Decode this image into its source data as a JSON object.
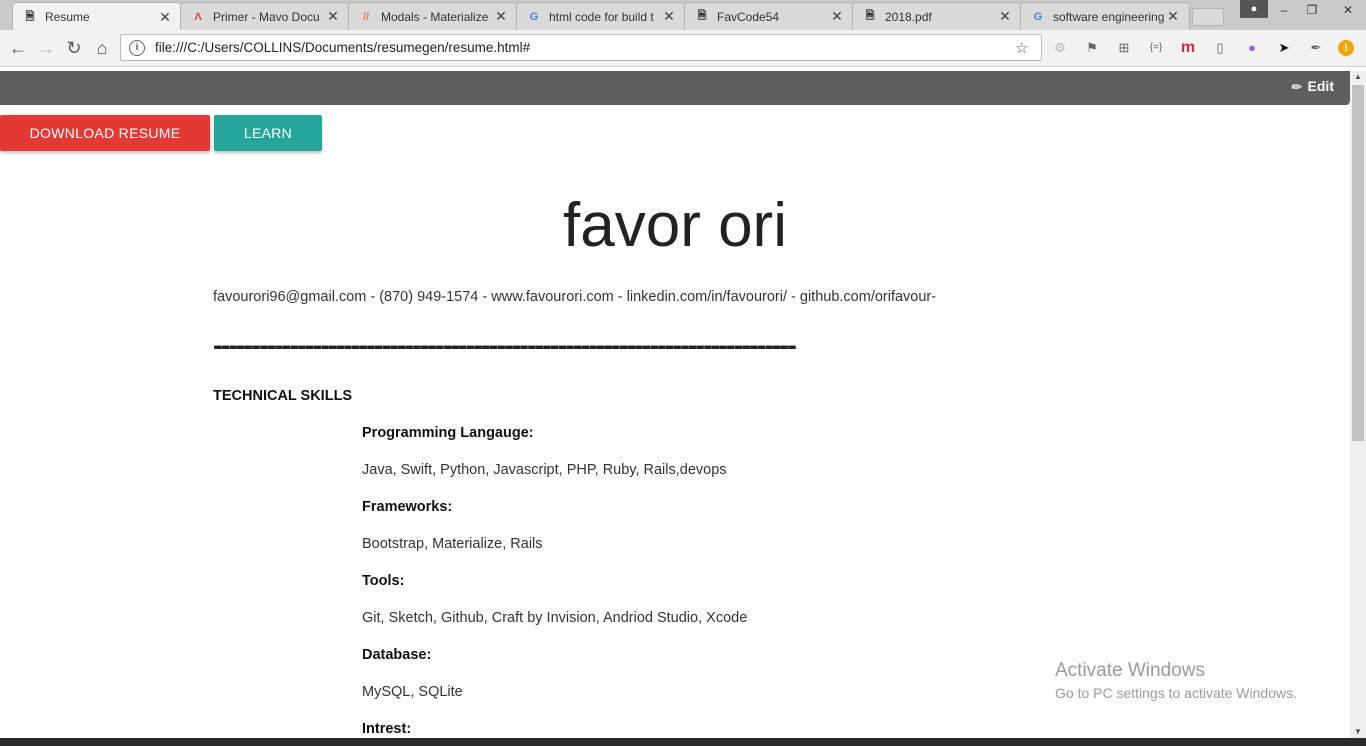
{
  "browser": {
    "tabs": [
      {
        "title": "Resume",
        "icon": "page-icon",
        "active": true
      },
      {
        "title": "Primer - Mavo Docu",
        "icon": "mavo-icon",
        "active": false
      },
      {
        "title": "Modals - Materialize",
        "icon": "materialize-icon",
        "active": false
      },
      {
        "title": "html code for build t",
        "icon": "google-icon",
        "active": false
      },
      {
        "title": "FavCode54",
        "icon": "page-icon",
        "active": false
      },
      {
        "title": "2018.pdf",
        "icon": "page-icon",
        "active": false
      },
      {
        "title": "software engineering",
        "icon": "google-icon",
        "active": false
      }
    ],
    "url": "file:///C:/Users/COLLINS/Documents/resumegen/resume.html#"
  },
  "appbar": {
    "edit_label": "Edit"
  },
  "buttons": {
    "download": "DOWNLOAD RESUME",
    "learn": "LEARN"
  },
  "resume": {
    "name": "favor ori",
    "contact": "favourori96@gmail.com - (870) 949-1574 - www.favourori.com - linkedin.com/in/favourori/ - github.com/orifavour-",
    "divider": "----------------------------------------------------------------------------",
    "section_title": "TECHNICAL SKILLS",
    "skills": [
      {
        "label": "Programming Langauge:",
        "value": "Java, Swift, Python, Javascript, PHP, Ruby, Rails,devops"
      },
      {
        "label": "Frameworks:",
        "value": "Bootstrap, Materialize, Rails"
      },
      {
        "label": "Tools:",
        "value": "Git, Sketch, Github, Craft by Invision, Andriod Studio, Xcode"
      },
      {
        "label": "Database:",
        "value": "MySQL, SQLite"
      },
      {
        "label": "Intrest:",
        "value": ""
      }
    ]
  },
  "watermark": {
    "line1": "Activate Windows",
    "line2": "Go to PC settings to activate Windows."
  },
  "colors": {
    "download": "#e53935",
    "learn": "#26a69a",
    "appbar": "#5e5e5e"
  }
}
